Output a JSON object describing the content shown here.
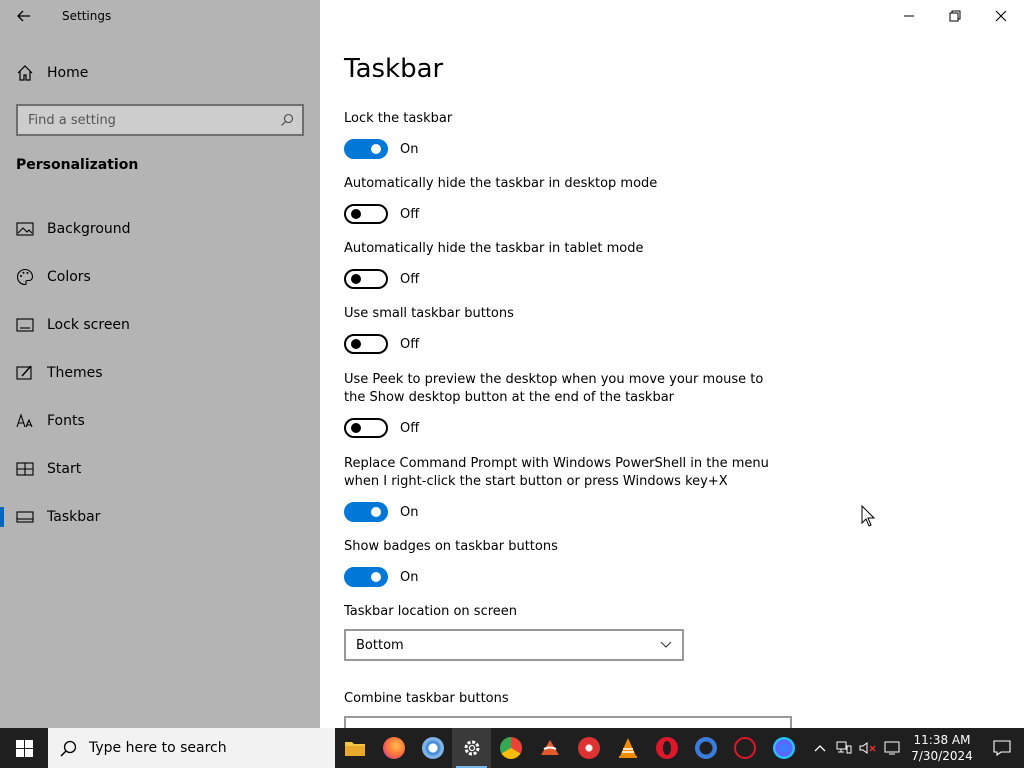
{
  "window": {
    "title": "Settings"
  },
  "sidebar": {
    "home_label": "Home",
    "search_placeholder": "Find a setting",
    "section_title": "Personalization",
    "items": [
      {
        "label": "Background",
        "icon": "picture-icon"
      },
      {
        "label": "Colors",
        "icon": "palette-icon"
      },
      {
        "label": "Lock screen",
        "icon": "lock-screen-icon"
      },
      {
        "label": "Themes",
        "icon": "themes-icon"
      },
      {
        "label": "Fonts",
        "icon": "fonts-icon"
      },
      {
        "label": "Start",
        "icon": "start-icon"
      },
      {
        "label": "Taskbar",
        "icon": "taskbar-icon",
        "active": true
      }
    ]
  },
  "main": {
    "title": "Taskbar",
    "settings": [
      {
        "label": "Lock the taskbar",
        "state": "On"
      },
      {
        "label": "Automatically hide the taskbar in desktop mode",
        "state": "Off"
      },
      {
        "label": "Automatically hide the taskbar in tablet mode",
        "state": "Off"
      },
      {
        "label": "Use small taskbar buttons",
        "state": "Off"
      },
      {
        "label": "Use Peek to preview the desktop when you move your mouse to the Show desktop button at the end of the taskbar",
        "state": "Off"
      },
      {
        "label": "Replace Command Prompt with Windows PowerShell in the menu when I right-click the start button or press Windows key+X",
        "state": "On"
      },
      {
        "label": "Show badges on taskbar buttons",
        "state": "On"
      }
    ],
    "location_label": "Taskbar location on screen",
    "location_value": "Bottom",
    "combine_label": "Combine taskbar buttons"
  },
  "taskbar": {
    "search_placeholder": "Type here to search",
    "apps": [
      {
        "name": "file-explorer-icon",
        "color": "#f4c542"
      },
      {
        "name": "firefox-icon",
        "color": "#ff7139"
      },
      {
        "name": "chromium-icon",
        "color": "#4a90d9"
      },
      {
        "name": "settings-gear-icon",
        "color": "#ffffff",
        "active": true
      },
      {
        "name": "chrome-icon",
        "color": "#34a853"
      },
      {
        "name": "app-red-icon",
        "color": "#e05a2b"
      },
      {
        "name": "app-red-circle-icon",
        "color": "#d33"
      },
      {
        "name": "vlc-icon",
        "color": "#f08c00"
      },
      {
        "name": "opera-icon",
        "color": "#e0162b"
      },
      {
        "name": "app-blue-icon",
        "color": "#3b7ddd"
      },
      {
        "name": "opera-gx-icon",
        "color": "#e0162b"
      },
      {
        "name": "app-purple-icon",
        "color": "#6a5cff"
      }
    ],
    "time": "11:38 AM",
    "date": "7/30/2024"
  },
  "colors": {
    "accent": "#0078d7",
    "sidebar_bg": "#b4b4b4",
    "taskbar_bg": "#1f1f1f"
  }
}
